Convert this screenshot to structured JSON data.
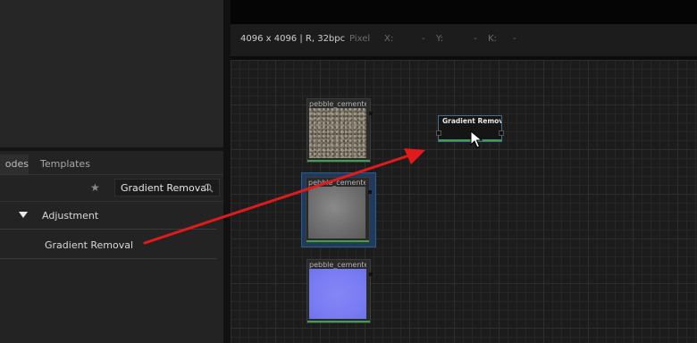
{
  "library": {
    "tabs": [
      {
        "label": "odes"
      },
      {
        "label": "Templates"
      }
    ],
    "search": {
      "value": "Gradient Removal"
    },
    "tree": {
      "category": "Adjustment",
      "item": "Gradient Removal"
    }
  },
  "viewer": {
    "resolution": "4096 x 4096 |  R, 32bpc",
    "pixel_label": "Pixel",
    "x_label": "X:",
    "x_value": "-",
    "y_label": "Y:",
    "y_value": "-",
    "k_label": "K:",
    "k_value": "-"
  },
  "graph": {
    "nodes": [
      {
        "title": "pebble_cemented"
      },
      {
        "title": "pebble_cemented"
      },
      {
        "title": "pebble_cemented"
      }
    ],
    "new_node": {
      "title": "Gradient Removal"
    }
  },
  "colors": {
    "arrow": "#e01b1b",
    "selection": "#2e5a8c",
    "output_bar": "#3f9f4f"
  }
}
